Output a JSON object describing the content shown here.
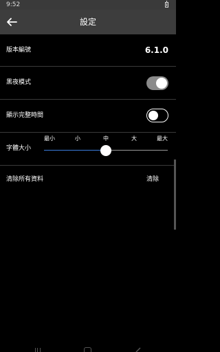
{
  "status_bar": {
    "time": "9:52",
    "battery_icon": "battery-icon"
  },
  "app_bar": {
    "title": "設定",
    "back_icon": "arrow-left-icon"
  },
  "settings": {
    "version": {
      "label": "版本編號",
      "value": "6.1.0"
    },
    "dark_mode": {
      "label": "黑夜模式",
      "enabled": true
    },
    "show_full_time": {
      "label": "顯示完整時間",
      "enabled": false
    },
    "font_size": {
      "label": "字體大小",
      "options": [
        "最小",
        "小",
        "中",
        "大",
        "最大"
      ],
      "selected": "中",
      "selected_index": 2
    },
    "clear_data": {
      "label": "清除所有資料",
      "action": "清除"
    }
  },
  "colors": {
    "accent": "#3b7ddd",
    "app_bar": "#3d3d3d",
    "background": "#000000",
    "toggle_on_track": "#8a8a8a"
  }
}
